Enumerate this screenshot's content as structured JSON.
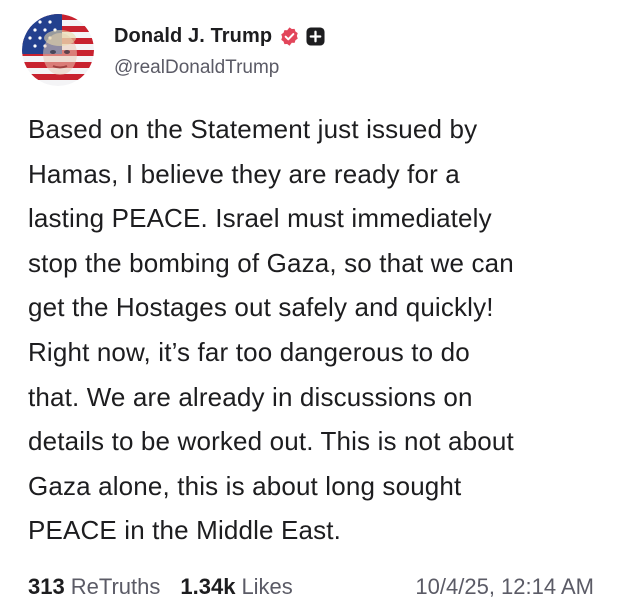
{
  "author": {
    "display_name": "Donald J. Trump",
    "handle": "@realDonaldTrump",
    "avatar_icon": "flag-portrait-avatar",
    "badges": [
      "verified-check-icon",
      "plus-badge-icon"
    ],
    "verified_color": "#e2455a"
  },
  "post": {
    "lines": [
      "Based on the Statement just issued by",
      "Hamas, I believe they are ready for a",
      "lasting PEACE. Israel must immediately",
      "stop the bombing of Gaza, so that we can",
      "get the Hostages out safely and quickly!",
      "Right now, it’s far too dangerous to do",
      "that. We are already in discussions on",
      "details to be worked out. This is not about",
      "Gaza alone, this is about long sought",
      "PEACE in the Middle East."
    ]
  },
  "stats": {
    "retruths_count": "313",
    "retruths_label": "ReTruths",
    "likes_count": "1.34k",
    "likes_label": "Likes",
    "timestamp": "10/4/25, 12:14 AM"
  }
}
